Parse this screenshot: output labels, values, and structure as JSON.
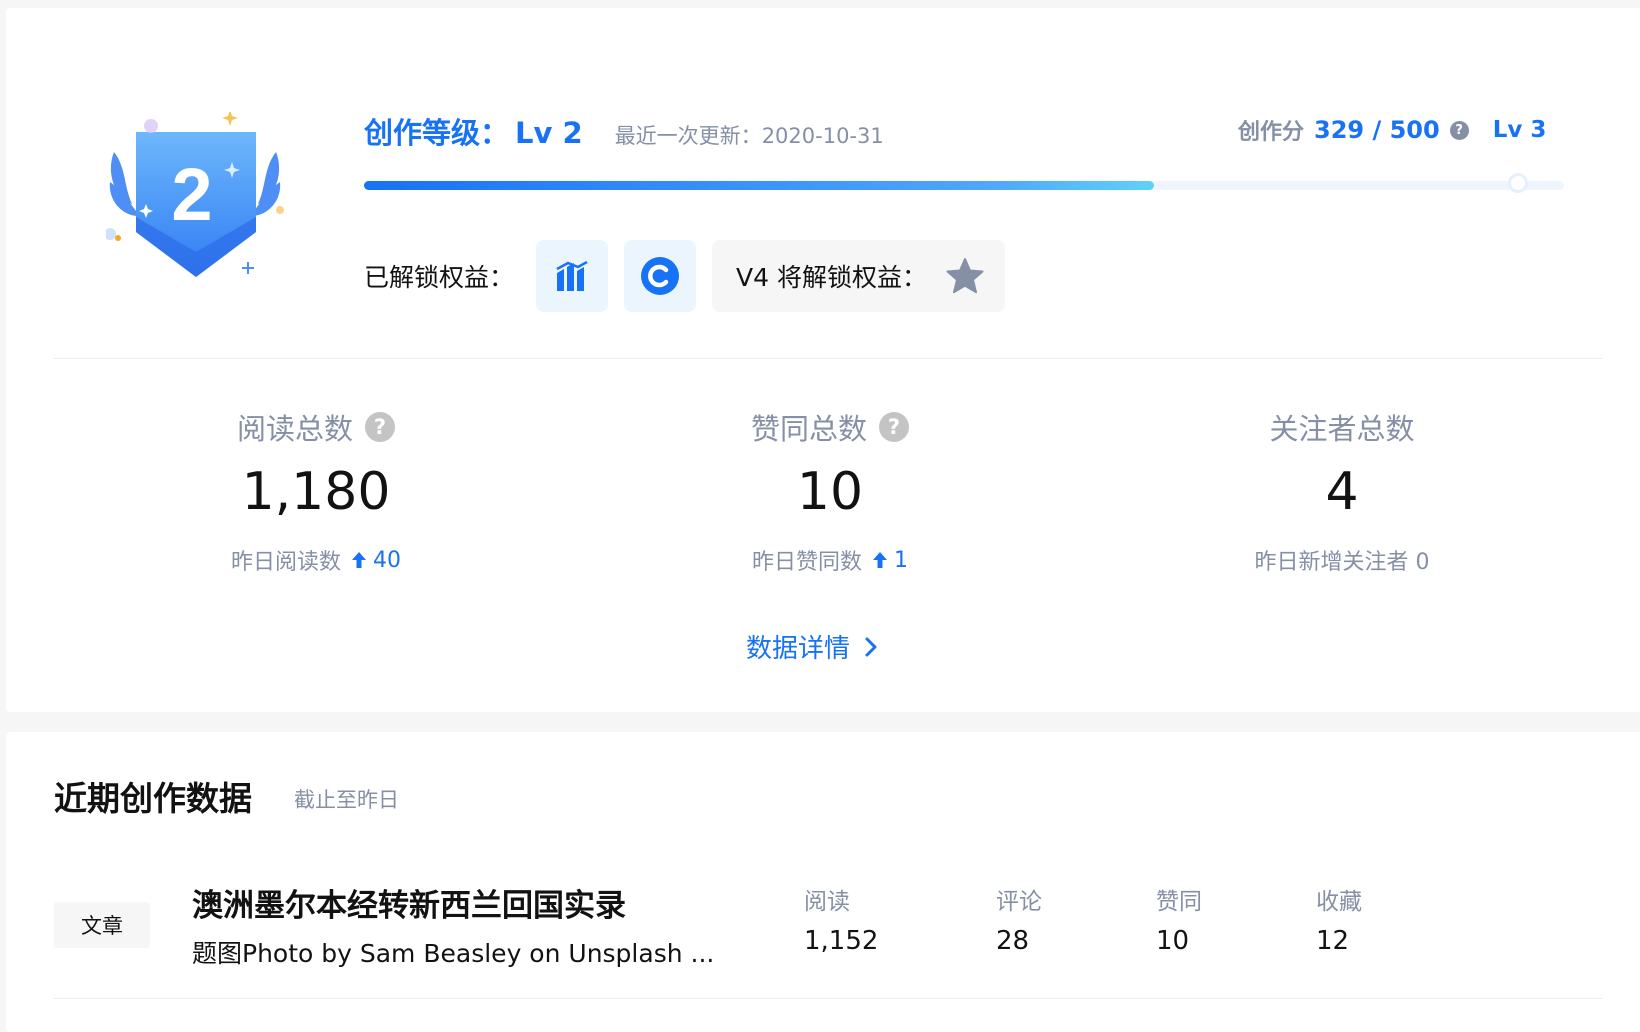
{
  "level_card": {
    "title": "创作等级：",
    "level": "Lv 2",
    "update_label": "最近一次更新：",
    "update_date": "2020-10-31",
    "score_label": "创作分",
    "score_value": "329 / 500",
    "help_glyph": "?",
    "next_level": "Lv 3",
    "progress": 0.658,
    "badge_number": "2",
    "unlocked_label": "已解锁权益：",
    "unlocked_perks": [
      {
        "icon": "bar-chart-icon"
      },
      {
        "icon": "copyright-icon"
      }
    ],
    "future_label": "V4 将解锁权益：",
    "future_icon": "star-icon"
  },
  "stats": [
    {
      "label": "阅读总数",
      "value": "1,180",
      "sub_label": "昨日阅读数",
      "sub_value": "40",
      "help": true
    },
    {
      "label": "赞同总数",
      "value": "10",
      "sub_label": "昨日赞同数",
      "sub_value": "1",
      "help": true
    },
    {
      "label": "关注者总数",
      "value": "4",
      "sub_label": "昨日新增关注者 0",
      "help": false
    }
  ],
  "detail_link": "数据详情",
  "recent": {
    "title": "近期创作数据",
    "subtitle": "截止至昨日",
    "rows": [
      {
        "tag": "文章",
        "title": "澳洲墨尔本经转新西兰回国实录",
        "desc": "题图Photo by Sam Beasley on Unsplash ...",
        "metrics": [
          {
            "label": "阅读",
            "value": "1,152"
          },
          {
            "label": "评论",
            "value": "28"
          },
          {
            "label": "赞同",
            "value": "10"
          },
          {
            "label": "收藏",
            "value": "12"
          }
        ]
      }
    ]
  },
  "colors": {
    "accent": "#1772f6",
    "muted": "#8590a6",
    "text": "#121212"
  }
}
